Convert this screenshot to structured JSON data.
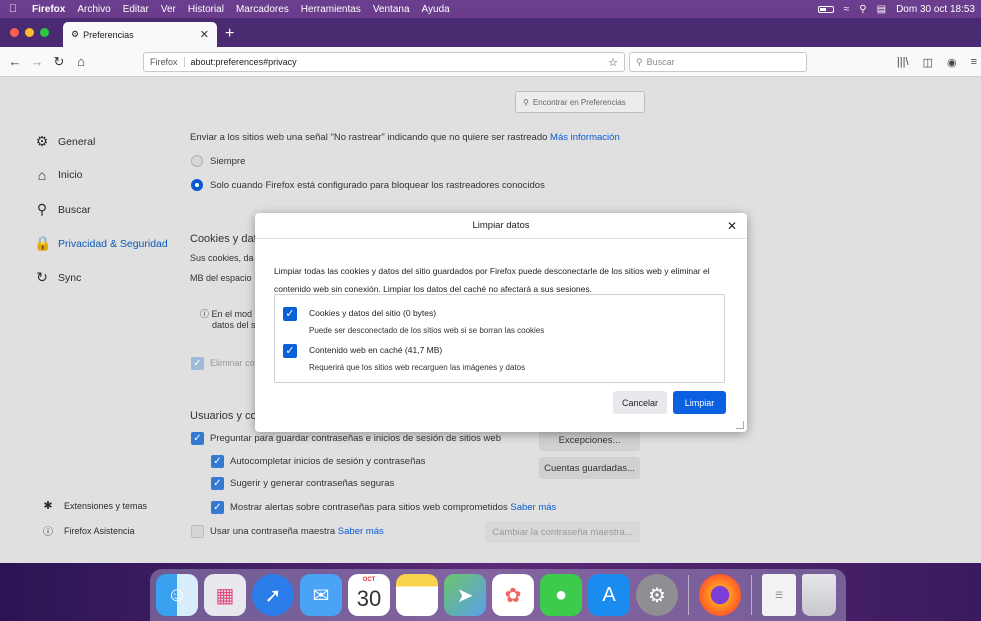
{
  "menubar": {
    "items": [
      "Firefox",
      "Archivo",
      "Editar",
      "Ver",
      "Historial",
      "Marcadores",
      "Herramientas",
      "Ventana",
      "Ayuda"
    ],
    "clock": "Dom 30 oct  18:53"
  },
  "tab": {
    "title": "Preferencias"
  },
  "navbar": {
    "identity": "Firefox",
    "url": "about:preferences#privacy",
    "search_placeholder": "Buscar"
  },
  "prefs": {
    "find_placeholder": "Encontrar en Preferencias",
    "sidebar": [
      "General",
      "Inicio",
      "Buscar",
      "Privacidad & Seguridad",
      "Sync"
    ],
    "sidebar_bottom": [
      "Extensiones y temas",
      "Firefox Asistencia"
    ],
    "dnt_text": "Enviar a los sitios web una señal \"No rastrear\" indicando que no quiere ser rastreado",
    "dnt_link": "Más información",
    "radio_always": "Siempre",
    "radio_only": "Solo cuando Firefox está configurado para bloquear los rastreadores conocidos",
    "cookies_heading": "Cookies y dat",
    "cookies_line1": "Sus cookies, da",
    "cookies_line2": "MB del espacio",
    "info_line1": "En el mod",
    "info_line2": "datos del s",
    "delete_label": "Eliminar co",
    "users_heading": "Usuarios y co",
    "ask_save": "Preguntar para guardar contraseñas e inicios de sesión de sitios web",
    "autofill": "Autocompletar inicios de sesión y contraseñas",
    "suggest": "Sugerir y generar contraseñas seguras",
    "alerts": "Mostrar alertas sobre contraseñas para sitios web comprometidos",
    "alerts_link": "Saber más",
    "master": "Usar una contraseña maestra",
    "master_link": "Saber más",
    "btn_exceptions": "Excepciones...",
    "btn_saved": "Cuentas guardadas...",
    "btn_change_master": "Cambiar la contraseña maestra..."
  },
  "dialog": {
    "title": "Limpiar datos",
    "description": "Limpiar todas las cookies y datos del sitio guardados por Firefox puede desconectarle de los sitios web y eliminar el contenido web sin conexión. Limpiar los datos del caché no afectará a sus sesiones.",
    "option1_label": "Cookies y datos del sitio (0 bytes)",
    "option1_sub": "Puede ser desconectado de los sitios web si se borran las cookies",
    "option2_label": "Contenido web en caché (41,7 MB)",
    "option2_sub": "Requerirá que los sitios web recarguen las imágenes y datos",
    "cancel": "Cancelar",
    "clear": "Limpiar"
  },
  "dock": {
    "calendar_month": "OCT",
    "calendar_day": "30"
  },
  "colors": {
    "accent": "#0a60e0",
    "menubar": "#6a3b8a"
  }
}
